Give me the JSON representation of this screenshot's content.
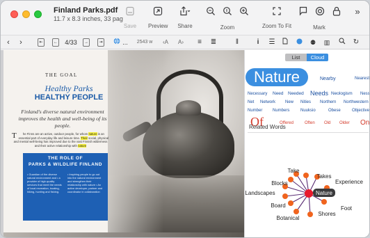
{
  "window": {
    "title": "Finland Parks.pdf",
    "subtitle": "11.7 x 8.3 inches, 33 pag..."
  },
  "toolbar": {
    "save": "Save",
    "preview": "Preview",
    "share": "Share",
    "zoom": "Zoom",
    "zoom_to_fit": "Zoom To Fit",
    "mark": "Mark",
    "more": "»"
  },
  "secondary_toolbar": {
    "page_indicator": "4/33",
    "word_count": "2543 w",
    "ellipsis": "..."
  },
  "document": {
    "section": "THE GOAL",
    "headline_italic": "Healthy Parks",
    "headline_bold": "HEALTHY PEOPLE",
    "intro": "Finland's diverse natural environment improves the health and well-being of its people.",
    "body_pre": "he Finns are an active, outdoor people, for whom",
    "body_hl1": "nature",
    "body_mid1": "is an essential part of everyday life and leisure time.",
    "body_hl2": "Their",
    "body_mid2": "social, physical and mental well-being has improved due to the vast Finnish wilderness and their active relationship with",
    "body_hl3": "nature",
    "body_drop": "T",
    "role_title_line1": "THE ROLE OF",
    "role_title_line2": "PARKS & WILDLIFE FINLAND",
    "role_col1": "• Guardian of the diverse natural environment and • a provider of high-quality services that meet the needs of local recreation, boating, hiking, hunting and fishing.",
    "role_col2": "• Inspiring people to go out into the natural environment and strengthen their relationship with nature • An active developer, partner and coordinator in collaboration"
  },
  "sidepanel": {
    "seg_list": "List",
    "seg_cloud": "Cloud",
    "related_title": "Related Words",
    "cloud_words": {
      "nature": "Nature",
      "nearby": "Nearby",
      "nearest": "Nearest",
      "necessary": "Necessary",
      "need": "Need",
      "needed": "Needed",
      "needs": "Needs",
      "neologism": "Neologism",
      "ness": "Ness",
      "net": "Net",
      "network": "Network",
      "new": "New",
      "nities": "Nities",
      "northern": "Northern",
      "northwestern": "Northwestern",
      "number": "Number",
      "numbers": "Numbers",
      "nuuksio": "Nuuksio",
      "obese": "Obese",
      "objective": "Objective",
      "of": "Of",
      "offered": "Offered",
      "often": "Often",
      "old": "Old",
      "older": "Older",
      "on": "On"
    },
    "graph": {
      "center": "Nature",
      "take": "Take",
      "takes": "Takes",
      "blocks": "Blocks",
      "experience": "Experience",
      "landscapes": "Landscapes",
      "board": "Board",
      "foot": "Foot",
      "shores": "Shores",
      "botanical": "Botanical"
    }
  },
  "colors": {
    "accent": "#3b8fe0",
    "headline": "#1a5aa7",
    "role_box": "#1e60b4",
    "highlight": "#f5ef3b",
    "cloud_red": "#d43a2a",
    "graph_node": "#f0641e",
    "graph_center": "#e8192c"
  }
}
